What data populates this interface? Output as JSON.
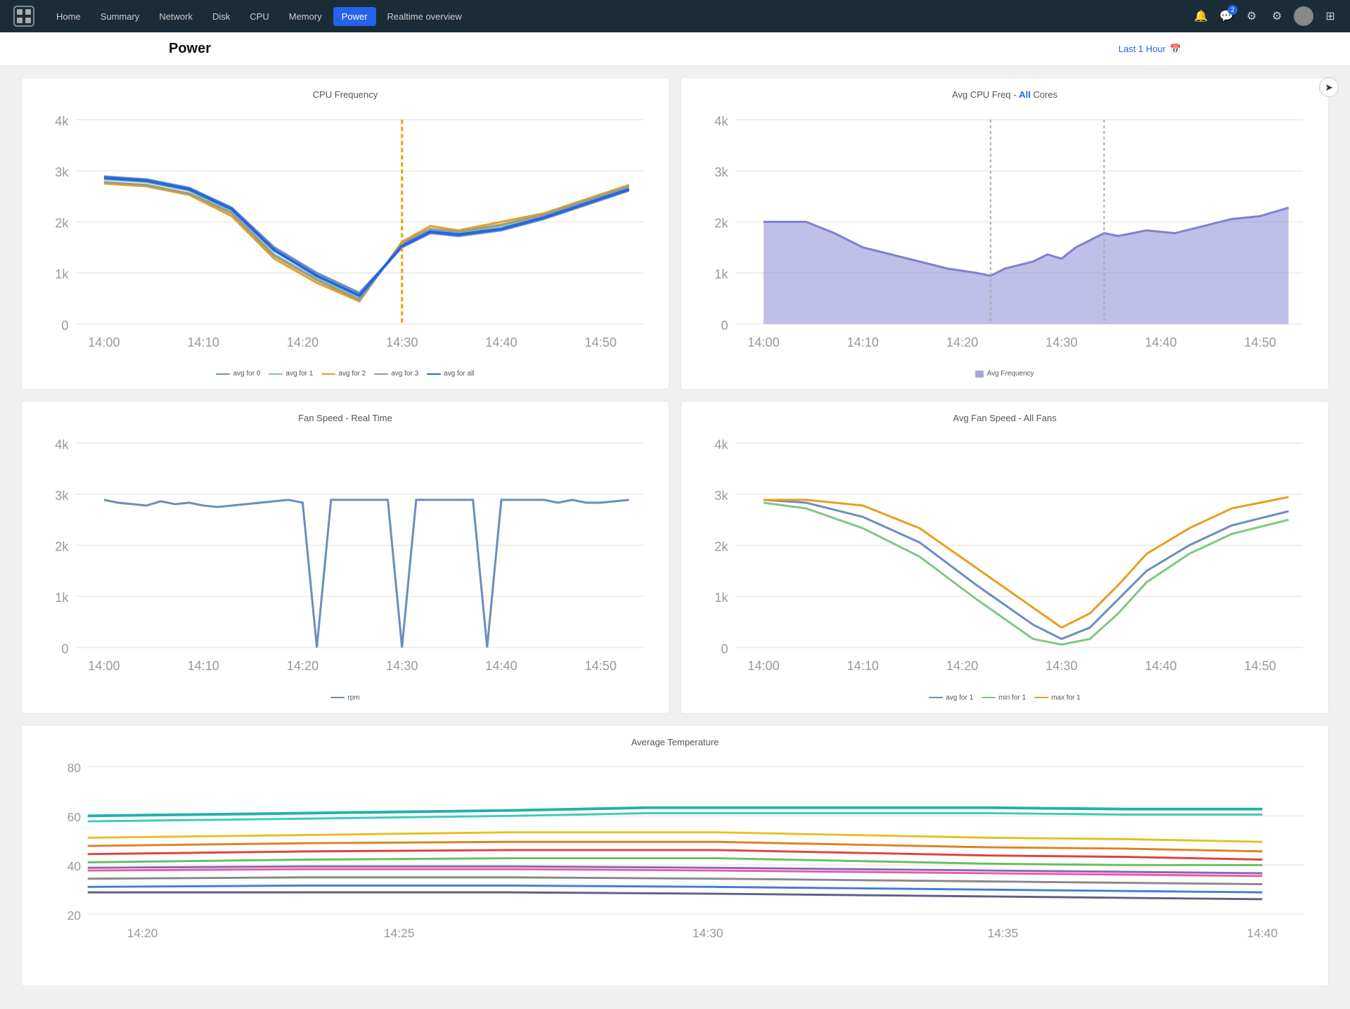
{
  "navbar": {
    "links": [
      {
        "label": "Home",
        "active": false
      },
      {
        "label": "Summary",
        "active": false
      },
      {
        "label": "Network",
        "active": false
      },
      {
        "label": "Disk",
        "active": false
      },
      {
        "label": "CPU",
        "active": false
      },
      {
        "label": "Memory",
        "active": false
      },
      {
        "label": "Power",
        "active": true
      },
      {
        "label": "Realtime overview",
        "active": false
      }
    ],
    "notification_count": "2"
  },
  "page": {
    "title": "Power",
    "time_range": "Last 1 Hour"
  },
  "charts": {
    "cpu_freq": {
      "title": "CPU Frequency",
      "y_labels": [
        "4k",
        "3k",
        "2k",
        "1k",
        "0"
      ],
      "x_labels": [
        "14:00",
        "14:10",
        "14:20",
        "14:30",
        "14:40",
        "14:50"
      ],
      "legends": [
        {
          "label": "avg for 0",
          "color": "#6c8ebf"
        },
        {
          "label": "avg for 1",
          "color": "#82c882"
        },
        {
          "label": "avg for 2",
          "color": "#e6a020"
        },
        {
          "label": "avg for 3",
          "color": "#666"
        },
        {
          "label": "avg for all",
          "color": "#2563eb"
        }
      ]
    },
    "avg_cpu_freq": {
      "title_prefix": "Avg CPU Freq - ",
      "title_highlight": "All",
      "title_suffix": " Cores",
      "y_labels": [
        "4k",
        "3k",
        "2k",
        "1k",
        "0"
      ],
      "x_labels": [
        "14:00",
        "14:10",
        "14:20",
        "14:30",
        "14:40",
        "14:50"
      ],
      "legends": [
        {
          "label": "Avg Frequency",
          "color": "#8080d0"
        }
      ]
    },
    "fan_speed": {
      "title": "Fan Speed - Real Time",
      "y_labels": [
        "4k",
        "3k",
        "2k",
        "1k",
        "0"
      ],
      "x_labels": [
        "14:00",
        "14:10",
        "14:20",
        "14:30",
        "14:40",
        "14:50"
      ],
      "legends": [
        {
          "label": "rpm",
          "color": "#6c8ebf"
        }
      ]
    },
    "avg_fan_speed": {
      "title_prefix": "Avg Fan Speed - ",
      "title_suffix": "All Fans",
      "y_labels": [
        "4k",
        "3k",
        "2k",
        "1k",
        "0"
      ],
      "x_labels": [
        "14:00",
        "14:10",
        "14:20",
        "14:30",
        "14:40",
        "14:50"
      ],
      "legends": [
        {
          "label": "avg for 1",
          "color": "#6c8ebf"
        },
        {
          "label": "min for 1",
          "color": "#82c882"
        },
        {
          "label": "max for 1",
          "color": "#e6a020"
        }
      ]
    },
    "avg_temp": {
      "title": "Average Temperature",
      "y_labels": [
        "80",
        "60",
        "40",
        "20"
      ],
      "x_labels": [
        "14:20",
        "14:25",
        "14:30",
        "14:35",
        "14:40"
      ]
    }
  }
}
